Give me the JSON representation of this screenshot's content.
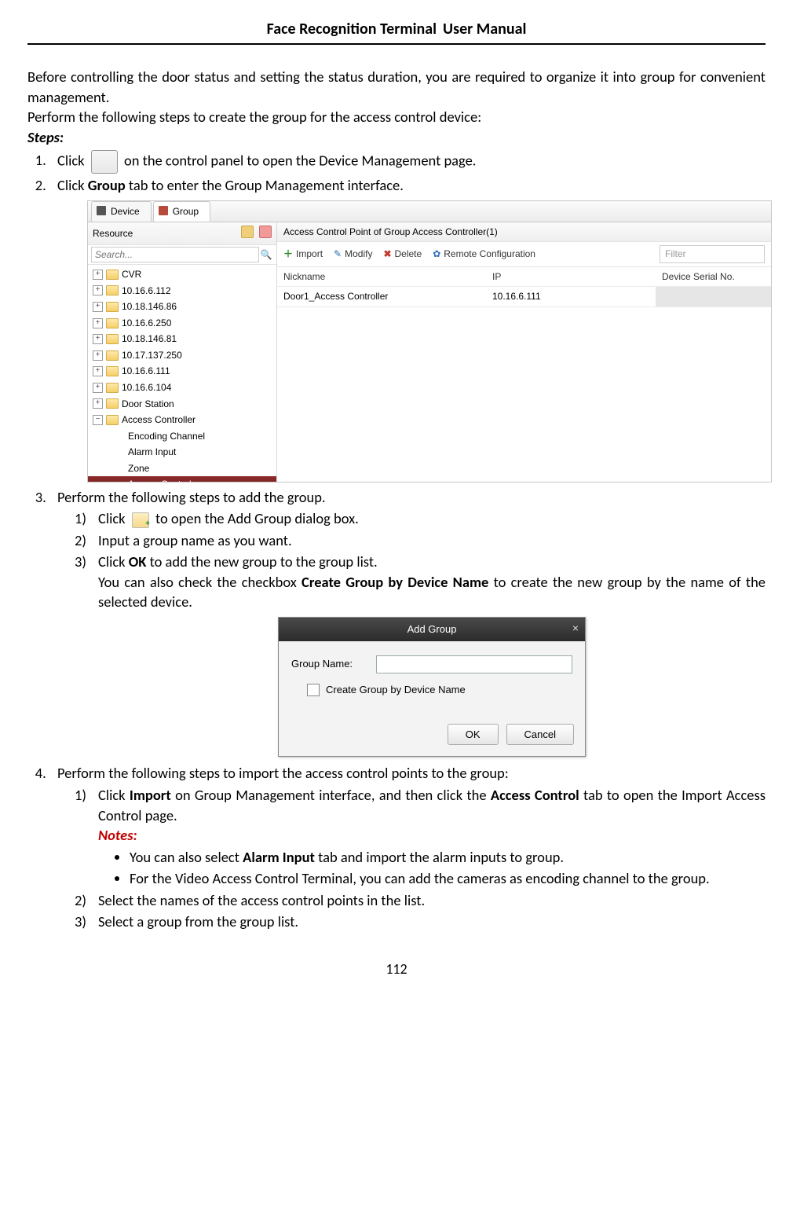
{
  "header": {
    "title_bold": "Face Recognition Terminal",
    "title_rest": "User Manual"
  },
  "intro": {
    "p1": "Before controlling the door status and setting the status duration, you are required to organize it into group for convenient management.",
    "p2": "Perform the following steps to create the group for the access control device:",
    "steps_label": "Steps:"
  },
  "step1": {
    "pre": "Click",
    "post": "on the control panel to open the Device Management page."
  },
  "step2": {
    "pre": "Click ",
    "bold": "Group",
    "post": " tab to enter the Group Management interface."
  },
  "shot1": {
    "tab_device": "Device",
    "tab_group": "Group",
    "left_title": "Resource",
    "search_placeholder": "Search...",
    "tree": [
      {
        "label": "CVR",
        "type": "folder"
      },
      {
        "label": "10.16.6.112",
        "type": "folder"
      },
      {
        "label": "10.18.146.86",
        "type": "folder"
      },
      {
        "label": "10.16.6.250",
        "type": "folder"
      },
      {
        "label": "10.18.146.81",
        "type": "folder"
      },
      {
        "label": "10.17.137.250",
        "type": "folder"
      },
      {
        "label": "10.16.6.111",
        "type": "folder"
      },
      {
        "label": "10.16.6.104",
        "type": "folder"
      },
      {
        "label": "Door Station",
        "type": "folder"
      },
      {
        "label": "Access Controller",
        "type": "folder",
        "expanded": true,
        "children": [
          {
            "label": "Encoding Channel"
          },
          {
            "label": "Alarm Input"
          },
          {
            "label": "Zone"
          },
          {
            "label": "Access Control",
            "selected": true
          }
        ]
      }
    ],
    "right_title": "Access Control Point of Group Access Controller(1)",
    "toolbar": {
      "import": "Import",
      "modify": "Modify",
      "delete": "Delete",
      "remote": "Remote Configuration",
      "filter": "Filter"
    },
    "columns": {
      "nickname": "Nickname",
      "ip": "IP",
      "serial": "Device Serial No."
    },
    "row": {
      "nickname": "Door1_Access Controller",
      "ip": "10.16.6.111",
      "serial": ""
    }
  },
  "step3": {
    "text": "Perform the following steps to add the group.",
    "s1_pre": "Click",
    "s1_post": "to open the Add Group dialog box.",
    "s2": "Input a group name as you want.",
    "s3_pre": "Click ",
    "s3_bold": "OK",
    "s3_mid": " to add the new group to the group list.",
    "s3_line2_pre": "You can also check the checkbox ",
    "s3_line2_bold": "Create Group by Device Name",
    "s3_line2_post": " to create the new group by the name of the selected device."
  },
  "shot2": {
    "title": "Add Group",
    "group_name_label": "Group Name:",
    "checkbox_label": "Create Group by Device Name",
    "ok": "OK",
    "cancel": "Cancel"
  },
  "step4": {
    "text": "Perform the following steps to import the access control points to the group:",
    "s1_pre": "Click ",
    "s1_bold1": "Import",
    "s1_mid1": " on Group Management interface, and then click the ",
    "s1_bold2": "Access Control",
    "s1_post": " tab to open the Import Access Control page.",
    "notes_label": "Notes:",
    "b1_pre": "You can also select ",
    "b1_bold": "Alarm Input",
    "b1_post": " tab and import the alarm inputs to group.",
    "b2": "For the Video Access Control Terminal, you can add the cameras as encoding channel to the group.",
    "s2": "Select the names of the access control points in the list.",
    "s3": "Select a group from the group list."
  },
  "page_number": "112"
}
